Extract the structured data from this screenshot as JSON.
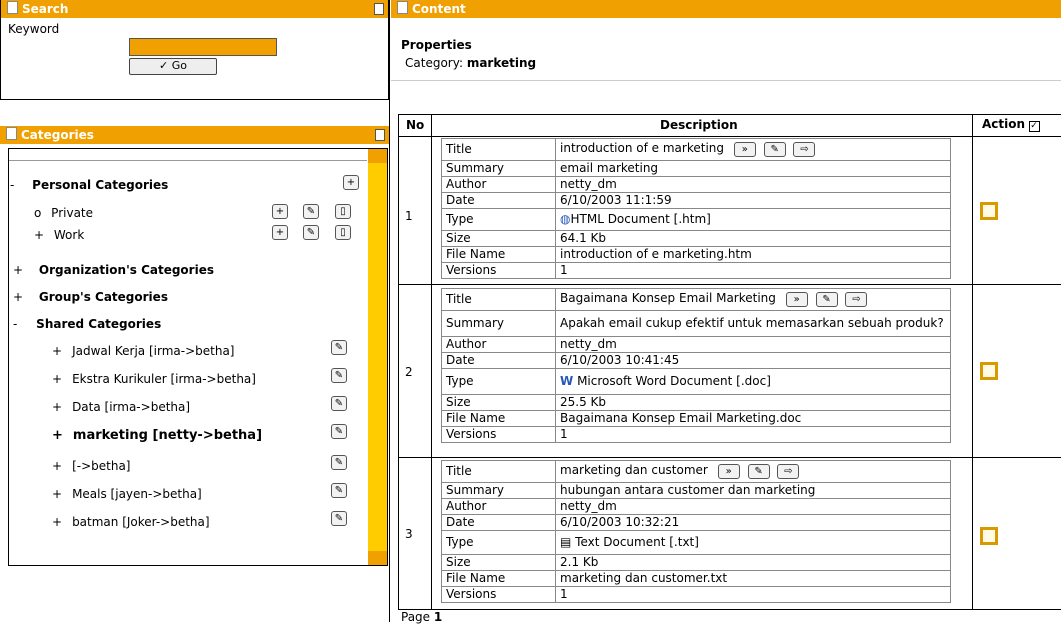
{
  "search": {
    "title": "Search",
    "keyword_label": "Keyword",
    "go_label": "✓ Go"
  },
  "categories": {
    "title": "Categories",
    "personal": "Personal Categories",
    "personal_items": [
      "Private",
      "Work"
    ],
    "organization": "Organization's Categories",
    "group": "Group's Categories",
    "shared": "Shared Categories",
    "shared_items": [
      "Jadwal Kerja [irma->betha]",
      "Ekstra Kurikuler [irma->betha]",
      "Data [irma->betha]",
      "marketing [netty->betha]",
      "[->betha]",
      "Meals [jayen->betha]",
      "batman [Joker->betha]"
    ]
  },
  "content": {
    "title": "Content",
    "properties_label": "Properties",
    "category_label": "Category:",
    "category_value": "marketing",
    "col_no": "No",
    "col_description": "Description",
    "col_action": "Action",
    "field_labels": [
      "Title",
      "Summary",
      "Author",
      "Date",
      "Type",
      "Size",
      "File Name",
      "Versions"
    ],
    "rows": [
      {
        "no": "1",
        "title": "introduction of e marketing",
        "summary": "email marketing",
        "author": "netty_dm",
        "date": "6/10/2003 11:1:59",
        "type": "HTML Document  [.htm]",
        "size": "64.1 Kb",
        "file_name": "introduction of e marketing.htm",
        "versions": "1"
      },
      {
        "no": "2",
        "title": "Bagaimana Konsep Email Marketing",
        "summary": "Apakah email cukup efektif untuk memasarkan sebuah produk?",
        "author": "netty_dm",
        "date": "6/10/2003 10:41:45",
        "type": "Microsoft Word Document  [.doc]",
        "size": "25.5 Kb",
        "file_name": "Bagaimana Konsep Email Marketing.doc",
        "versions": "1"
      },
      {
        "no": "3",
        "title": "marketing dan customer",
        "summary": "hubungan antara customer dan marketing",
        "author": "netty_dm",
        "date": "6/10/2003 10:32:21",
        "type": "Text Document  [.txt]",
        "size": "2.1 Kb",
        "file_name": "marketing dan customer.txt",
        "versions": "1"
      }
    ],
    "page_label": "Page",
    "page_number": "1"
  },
  "colors": {
    "accent": "#f0a000",
    "scrollbar": "#ffcc00"
  },
  "icons": {
    "expand": "plus-box-icon",
    "edit": "edit-icon",
    "folder": "page-icon",
    "detail": "chevron-down-icon",
    "export": "export-icon"
  }
}
